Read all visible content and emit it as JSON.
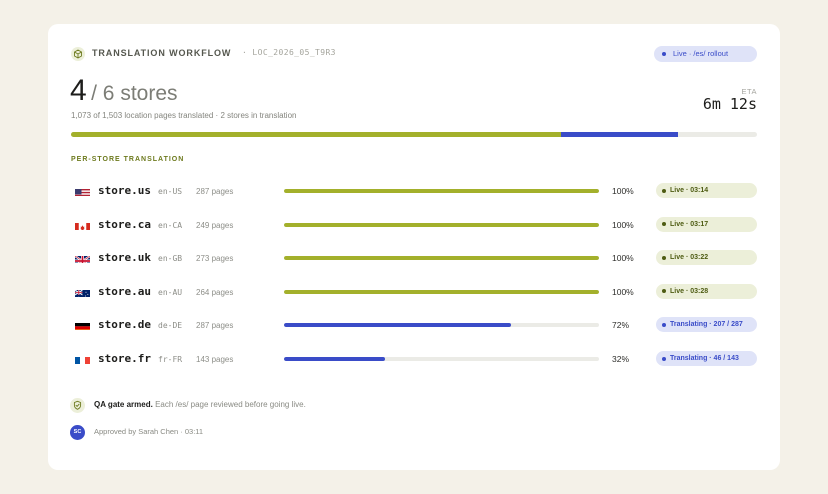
{
  "header": {
    "title": "TRANSLATION WORKFLOW",
    "workflow_id": "· LOC_2026_05_T9R3",
    "status_pill": "Live · /es/ rollout"
  },
  "summary": {
    "stores_done": "4",
    "stores_total_text": "/ 6 stores",
    "subline": "1,073 of 1,503 location pages translated · 2 stores in translation",
    "eta_label": "ETA",
    "eta_value": "6m 12s",
    "progress": {
      "live_fraction": 0.7143,
      "translating_fraction": 0.1707
    }
  },
  "section_title": "PER-STORE TRANSLATION",
  "stores": [
    {
      "flag": "us-flag",
      "name": "store.us",
      "locale": "en-US",
      "pages": "287 pages",
      "percent": "100%",
      "progress": 1.0,
      "state": "live",
      "status": "Live · 03:14"
    },
    {
      "flag": "ca-flag",
      "name": "store.ca",
      "locale": "en-CA",
      "pages": "249 pages",
      "percent": "100%",
      "progress": 1.0,
      "state": "live",
      "status": "Live · 03:17"
    },
    {
      "flag": "uk-flag",
      "name": "store.uk",
      "locale": "en-GB",
      "pages": "273 pages",
      "percent": "100%",
      "progress": 1.0,
      "state": "live",
      "status": "Live · 03:22"
    },
    {
      "flag": "au-flag",
      "name": "store.au",
      "locale": "en-AU",
      "pages": "264 pages",
      "percent": "100%",
      "progress": 1.0,
      "state": "live",
      "status": "Live · 03:28"
    },
    {
      "flag": "de-flag",
      "name": "store.de",
      "locale": "de-DE",
      "pages": "287 pages",
      "percent": "72%",
      "progress": 0.72,
      "state": "translating",
      "status": "Translating · 207 / 287"
    },
    {
      "flag": "fr-flag",
      "name": "store.fr",
      "locale": "fr-FR",
      "pages": "143 pages",
      "percent": "32%",
      "progress": 0.32,
      "state": "translating",
      "status": "Translating · 46 / 143"
    }
  ],
  "qa": {
    "bold": "QA gate armed.",
    "text": " Each /es/ page reviewed before going live."
  },
  "approval": {
    "initials": "SC",
    "text": "Approved by Sarah Chen · 03:11"
  },
  "colors": {
    "live": "#a3b02b",
    "translating": "#3a4cc8",
    "track": "#ebebe6",
    "background": "#f4f1e8"
  }
}
